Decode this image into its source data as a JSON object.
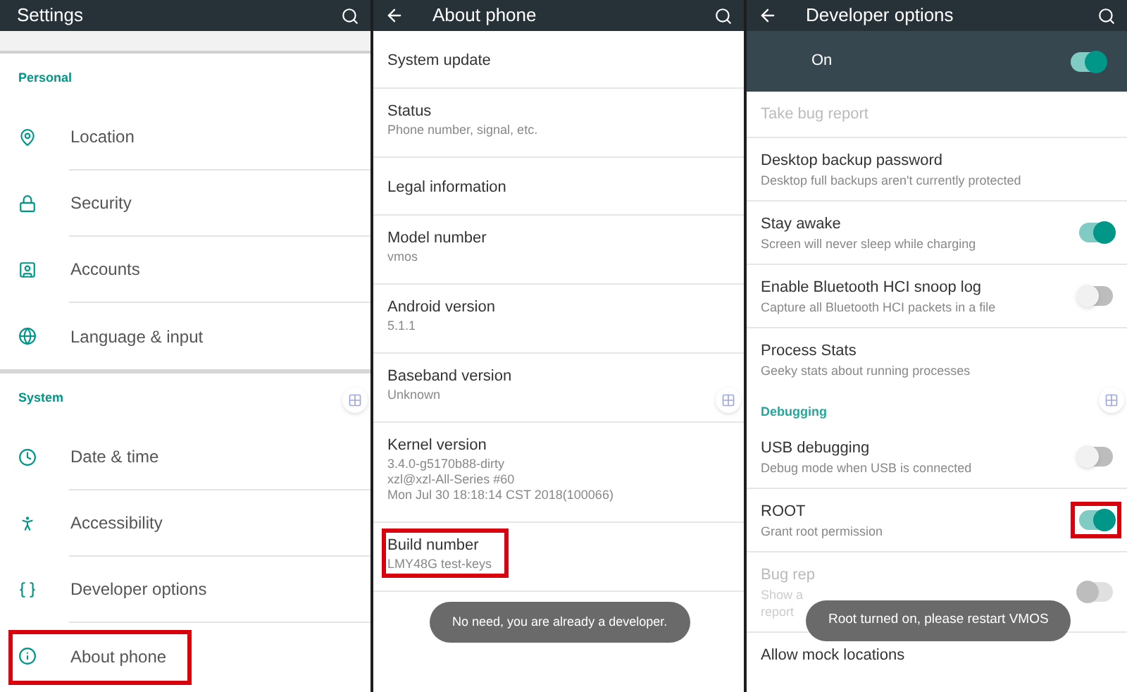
{
  "settings": {
    "title": "Settings",
    "sections": [
      {
        "header": "Personal",
        "items": [
          {
            "label": "Location",
            "highlighted": false
          },
          {
            "label": "Security",
            "highlighted": false
          },
          {
            "label": "Accounts",
            "highlighted": false
          },
          {
            "label": "Language & input",
            "highlighted": false
          }
        ]
      },
      {
        "header": "System",
        "items": [
          {
            "label": "Date & time",
            "highlighted": false
          },
          {
            "label": "Accessibility",
            "highlighted": false
          },
          {
            "label": "Developer options",
            "highlighted": false
          },
          {
            "label": "About phone",
            "highlighted": true
          }
        ]
      }
    ]
  },
  "about_phone": {
    "title": "About phone",
    "items": [
      {
        "title": "System update",
        "highlighted": false
      },
      {
        "title": "Status",
        "summary": [
          "Phone number, signal, etc."
        ],
        "highlighted": false
      },
      {
        "title": "Legal information",
        "highlighted": false
      },
      {
        "title": "Model number",
        "summary": [
          "vmos"
        ],
        "highlighted": false
      },
      {
        "title": "Android version",
        "summary": [
          "5.1.1"
        ],
        "highlighted": false
      },
      {
        "title": "Baseband version",
        "summary": [
          "Unknown"
        ],
        "highlighted": false
      },
      {
        "title": "Kernel version",
        "summary": [
          "3.4.0-g5170b88-dirty",
          "xzl@xzl-All-Series #60",
          "Mon Jul 30 18:18:14 CST 2018(100066)"
        ],
        "highlighted": false
      },
      {
        "title": "Build number",
        "summary": [
          "LMY48G test-keys"
        ],
        "highlighted": true
      }
    ],
    "toast": "No need, you are already a developer."
  },
  "developer_options": {
    "title": "Developer options",
    "master": {
      "label": "On",
      "on": true
    },
    "items": [
      {
        "kind": "action",
        "title": "Take bug report",
        "disabled": true
      },
      {
        "kind": "action",
        "title": "Desktop backup password",
        "summary": [
          "Desktop full backups aren't currently protected"
        ],
        "disabled": false
      },
      {
        "kind": "toggle",
        "title": "Stay awake",
        "summary": [
          "Screen will never sleep while charging"
        ],
        "on": true,
        "disabled": false,
        "highlighted": false
      },
      {
        "kind": "toggle",
        "title": "Enable Bluetooth HCI snoop log",
        "summary": [
          "Capture all Bluetooth HCI packets in a file"
        ],
        "on": false,
        "disabled": false,
        "highlighted": false
      },
      {
        "kind": "action",
        "title": "Process Stats",
        "summary": [
          "Geeky stats about running processes"
        ],
        "disabled": false
      },
      {
        "kind": "header",
        "title": "Debugging"
      },
      {
        "kind": "toggle",
        "title": "USB debugging",
        "summary": [
          "Debug mode when USB is connected"
        ],
        "on": false,
        "disabled": false,
        "highlighted": false
      },
      {
        "kind": "toggle",
        "title": "ROOT",
        "summary": [
          "Grant root permission"
        ],
        "on": true,
        "disabled": false,
        "highlighted": true
      },
      {
        "kind": "toggle",
        "title": "Bug rep",
        "summary": [
          "Show a",
          "report"
        ],
        "on": false,
        "disabled": true,
        "highlighted": false
      },
      {
        "kind": "action",
        "title": "Allow mock locations",
        "disabled": false
      }
    ],
    "toast": "Root turned on, please restart VMOS"
  }
}
